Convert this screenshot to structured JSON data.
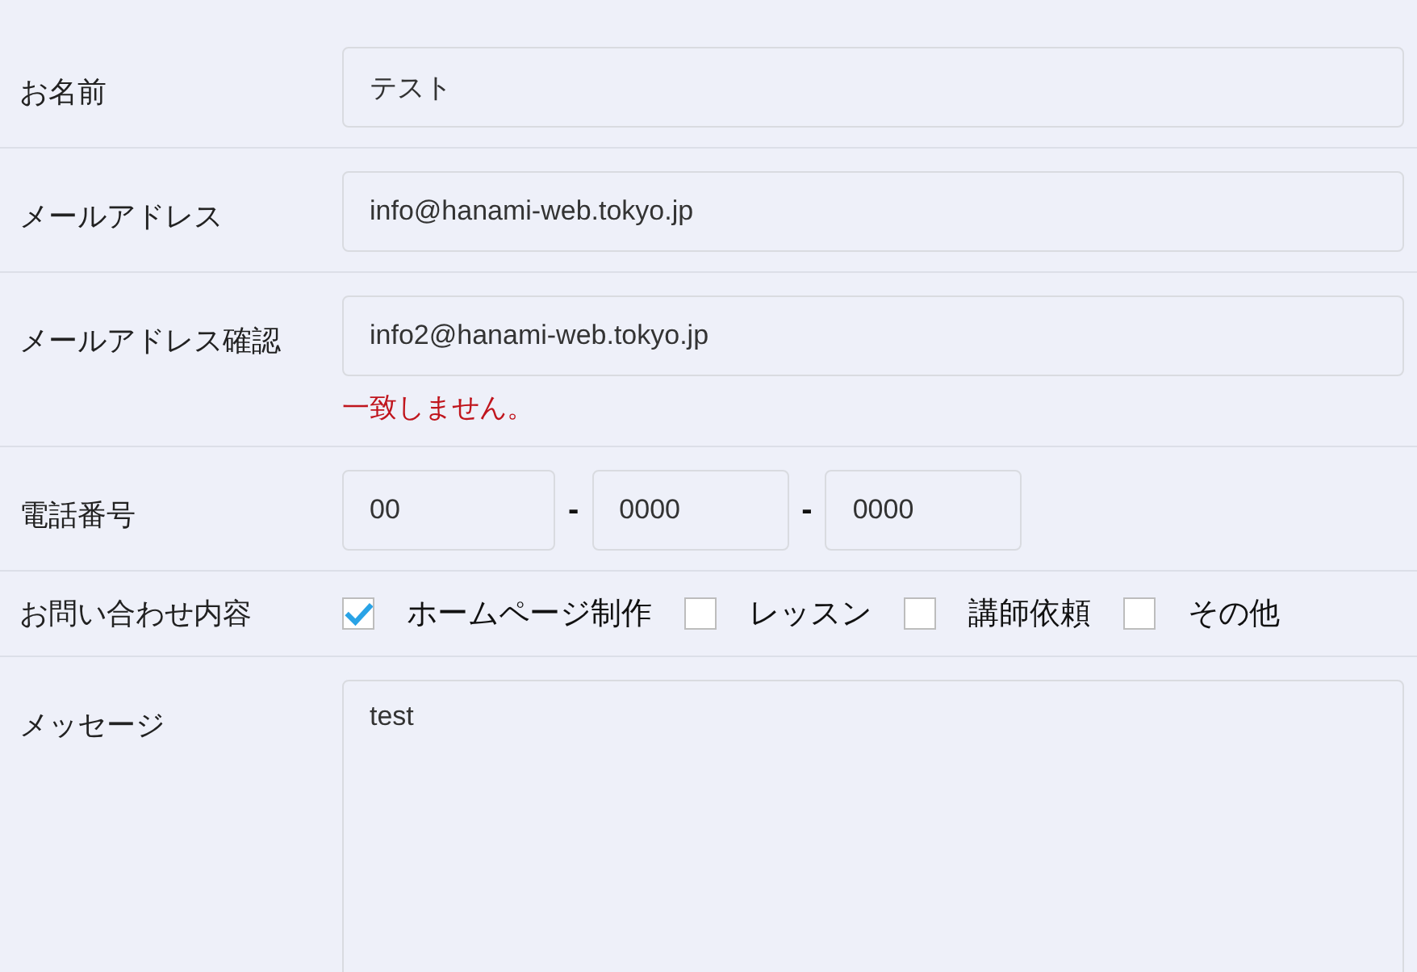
{
  "fields": [
    {
      "kind": "text",
      "label": "お名前",
      "value": "テスト"
    },
    {
      "kind": "text",
      "label": "メールアドレス",
      "value": "info@hanami-web.tokyo.jp"
    },
    {
      "kind": "text",
      "label": "メールアドレス確認",
      "value": "info2@hanami-web.tokyo.jp",
      "error": "一致しません。"
    },
    {
      "kind": "tel",
      "label": "電話番号",
      "parts": [
        "00",
        "0000",
        "0000"
      ],
      "separators": [
        "-",
        "-"
      ]
    },
    {
      "kind": "checkboxes",
      "label": "お問い合わせ内容",
      "options": [
        {
          "label": "ホームページ制作",
          "checked": true
        },
        {
          "label": "レッスン",
          "checked": false
        },
        {
          "label": "講師依頼",
          "checked": false
        },
        {
          "label": "その他",
          "checked": false
        }
      ]
    },
    {
      "kind": "textarea",
      "label": "メッセージ",
      "value": "test"
    }
  ]
}
